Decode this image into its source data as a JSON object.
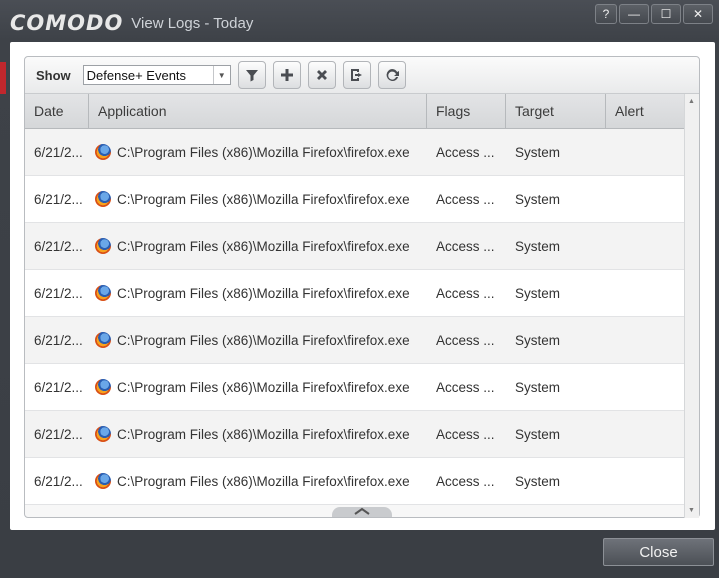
{
  "window": {
    "brand": "COMODO",
    "title": "View Logs - Today",
    "controls": {
      "help": "?",
      "minimize": "—",
      "maximize": "☐",
      "close": "✕"
    }
  },
  "toolbar": {
    "show_label": "Show",
    "filter_value": "Defense+ Events",
    "buttons": [
      "filter-icon",
      "plus-icon",
      "x-icon",
      "export-icon",
      "refresh-icon"
    ]
  },
  "table": {
    "columns": [
      "Date",
      "Application",
      "Flags",
      "Target",
      "Alert"
    ],
    "rows": [
      {
        "date": "6/21/2...",
        "application": "C:\\Program Files (x86)\\Mozilla Firefox\\firefox.exe",
        "flags": "Access ...",
        "target": "System",
        "alert": ""
      },
      {
        "date": "6/21/2...",
        "application": "C:\\Program Files (x86)\\Mozilla Firefox\\firefox.exe",
        "flags": "Access ...",
        "target": "System",
        "alert": ""
      },
      {
        "date": "6/21/2...",
        "application": "C:\\Program Files (x86)\\Mozilla Firefox\\firefox.exe",
        "flags": "Access ...",
        "target": "System",
        "alert": ""
      },
      {
        "date": "6/21/2...",
        "application": "C:\\Program Files (x86)\\Mozilla Firefox\\firefox.exe",
        "flags": "Access ...",
        "target": "System",
        "alert": ""
      },
      {
        "date": "6/21/2...",
        "application": "C:\\Program Files (x86)\\Mozilla Firefox\\firefox.exe",
        "flags": "Access ...",
        "target": "System",
        "alert": ""
      },
      {
        "date": "6/21/2...",
        "application": "C:\\Program Files (x86)\\Mozilla Firefox\\firefox.exe",
        "flags": "Access ...",
        "target": "System",
        "alert": ""
      },
      {
        "date": "6/21/2...",
        "application": "C:\\Program Files (x86)\\Mozilla Firefox\\firefox.exe",
        "flags": "Access ...",
        "target": "System",
        "alert": ""
      },
      {
        "date": "6/21/2...",
        "application": "C:\\Program Files (x86)\\Mozilla Firefox\\firefox.exe",
        "flags": "Access ...",
        "target": "System",
        "alert": ""
      }
    ]
  },
  "footer": {
    "close_label": "Close"
  },
  "colors": {
    "accent_red": "#c1272d",
    "window_bg": "#3e4248"
  }
}
